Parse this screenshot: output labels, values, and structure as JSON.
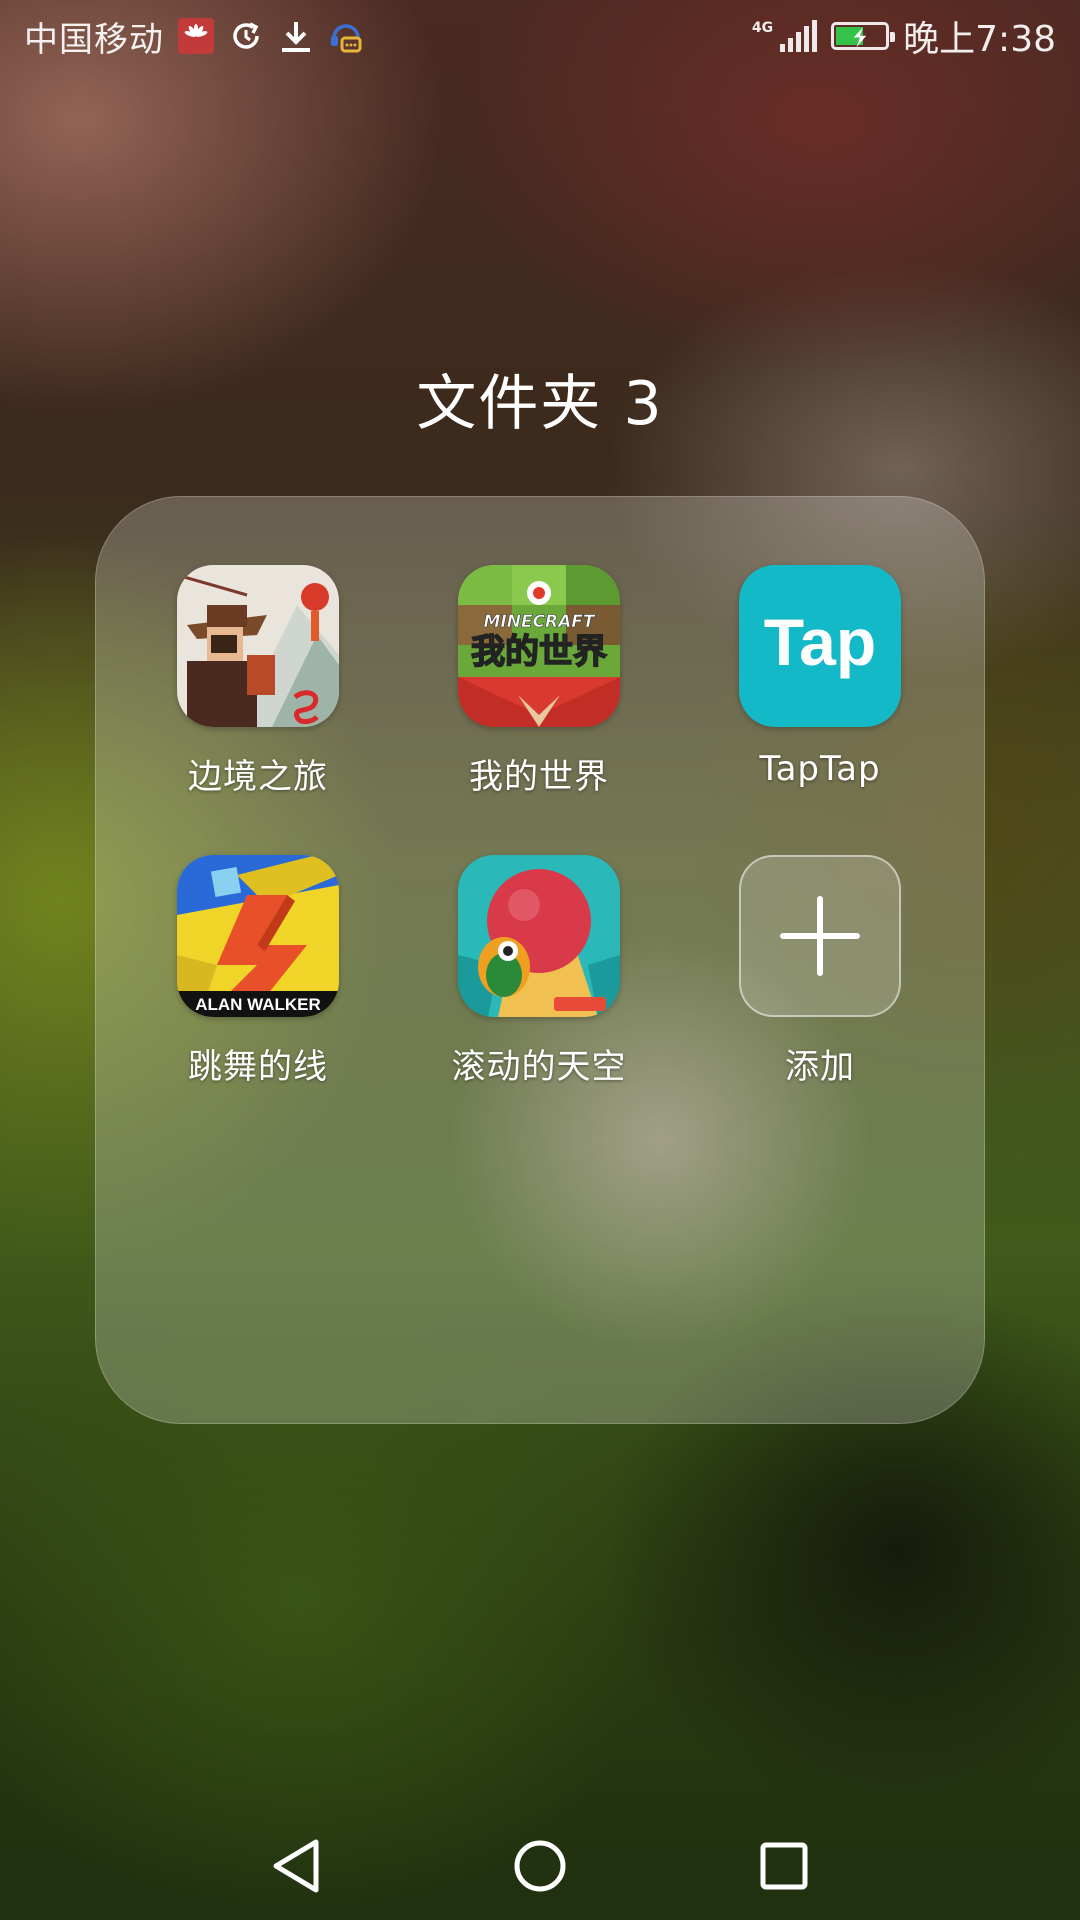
{
  "status_bar": {
    "carrier": "中国移动",
    "network": "4G",
    "time": "晚上7:38",
    "battery_level": 0.55,
    "icons": [
      "huawei-icon",
      "sync-icon",
      "download-icon",
      "message-icon"
    ]
  },
  "folder": {
    "title": "文件夹 3",
    "apps": [
      {
        "label": "边境之旅",
        "icon": "bianjing-app-icon"
      },
      {
        "label": "我的世界",
        "icon": "minecraft-app-icon",
        "icon_text_top": "MINECRAFT",
        "icon_text_main": "我的世界"
      },
      {
        "label": "TapTap",
        "icon": "taptap-app-icon",
        "icon_text": "Tap"
      },
      {
        "label": "跳舞的线",
        "icon": "dancing-line-app-icon",
        "icon_text": "ALAN WALKER"
      },
      {
        "label": "滚动的天空",
        "icon": "rolling-sky-app-icon"
      }
    ],
    "add_label": "添加"
  },
  "nav_bar": {
    "buttons": [
      "back",
      "home",
      "recents"
    ]
  },
  "colors": {
    "taptap_bg": "#14b9c8",
    "minecraft_red": "#d93a2f",
    "battery_fill": "#34c24a"
  }
}
